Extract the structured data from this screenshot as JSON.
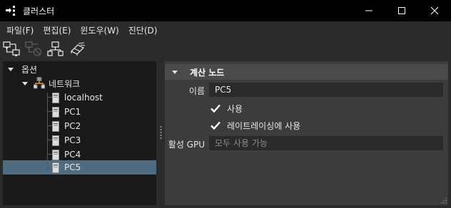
{
  "window": {
    "title": "클러스터",
    "controls": {
      "minimize": "minimize-icon",
      "maximize": "maximize-icon",
      "close": "close-icon"
    }
  },
  "menu": [
    "파일(F)",
    "편집(E)",
    "윈도우(W)",
    "진단(D)"
  ],
  "toolbar": {
    "icons": [
      "add-network-icon",
      "remove-network-icon",
      "network-node-icon",
      "eraser-icon"
    ],
    "disabled": [
      "remove-network-icon"
    ]
  },
  "tree": {
    "root": {
      "label": "옵션",
      "expanded": true
    },
    "network": {
      "label": "네트워크",
      "expanded": true
    },
    "nodes": [
      "localhost",
      "PC1",
      "PC2",
      "PC3",
      "PC4",
      "PC5"
    ],
    "selected": "PC5"
  },
  "props": {
    "section_title": "계산 노드",
    "name_label": "이름",
    "name_value": "PC5",
    "use_label": "사용",
    "use_checked": true,
    "raytracing_label": "레이트레이싱에 사용",
    "raytracing_checked": true,
    "gpu_label": "활성 GPU",
    "gpu_placeholder": "모두 사용 가능"
  },
  "colors": {
    "titlebar": "#000000",
    "background": "#2b2b2b",
    "tree_bg": "#191919",
    "selection": "#4f6b80",
    "panel_bg": "#3c3c3c",
    "section_bg": "#4a4a4a",
    "field_bg": "#2a2a2a"
  }
}
